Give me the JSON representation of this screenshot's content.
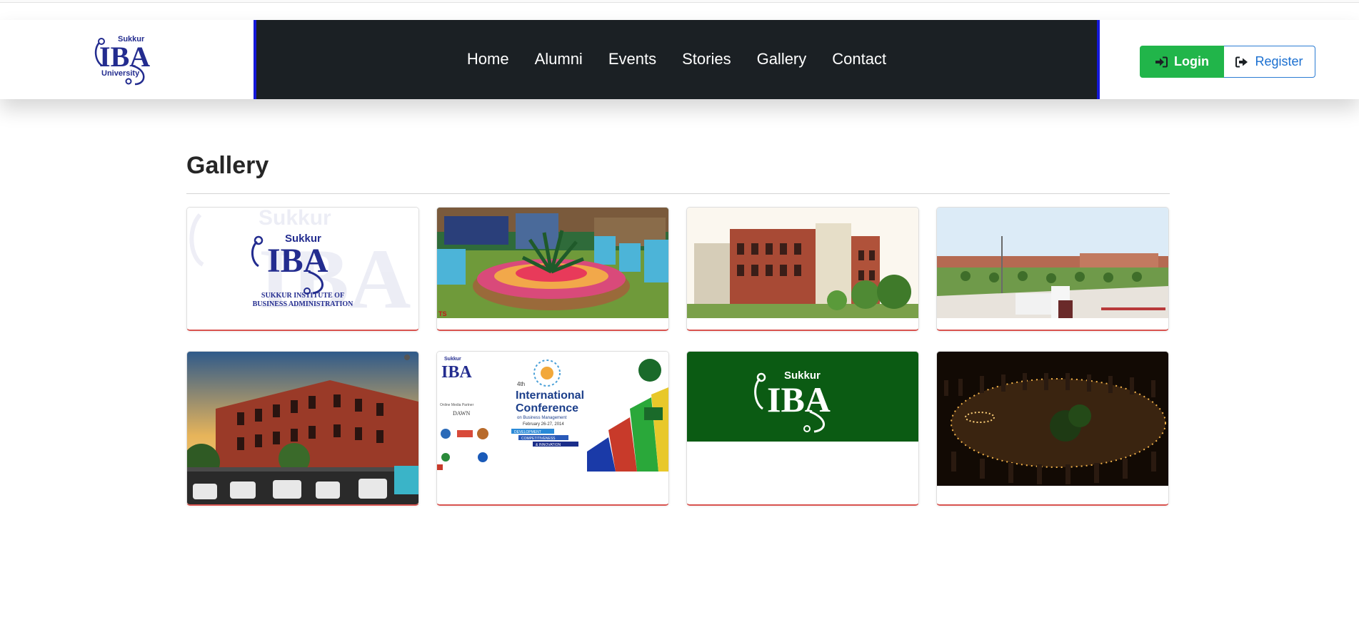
{
  "header": {
    "logo": {
      "alt": "Sukkur IBA University",
      "word_top": "Sukkur",
      "word_main": "IBA",
      "word_bottom": "University"
    },
    "nav": [
      {
        "label": "Home"
      },
      {
        "label": "Alumni"
      },
      {
        "label": "Events"
      },
      {
        "label": "Stories"
      },
      {
        "label": "Gallery"
      },
      {
        "label": "Contact"
      }
    ],
    "auth": {
      "login_label": "Login",
      "login_icon": "sign-in-icon",
      "register_label": "Register",
      "register_icon": "sign-out-icon"
    }
  },
  "page": {
    "title": "Gallery"
  },
  "gallery": {
    "items": [
      {
        "image": "sukkur-iba-logo-watermark",
        "text": {
          "top": "Sukkur",
          "main": "IBA",
          "line1": "Sukkur Institute of",
          "line2": "Business Administration"
        }
      },
      {
        "image": "flower-garden-event"
      },
      {
        "image": "campus-building-red-brick"
      },
      {
        "image": "campus-gate-lawn"
      },
      {
        "image": "campus-building-dramatic-sky"
      },
      {
        "image": "conference-poster",
        "text": {
          "logo_top": "Sukkur",
          "logo_main": "IBA",
          "edition": "4th",
          "title_1": "International",
          "title_2": "Conference",
          "subtitle": "on Business Management",
          "date": "February 26-27, 2014",
          "tag_1": "DEVELOPMENT",
          "tag_2": "COMPETITIVENESS",
          "tag_3": "& INNOVATION",
          "partner_label": "Online Media Partner",
          "partner": "DAWN"
        }
      },
      {
        "image": "sukkur-iba-green-logo",
        "text": {
          "top": "Sukkur",
          "main": "IBA"
        }
      },
      {
        "image": "candle-light-ceremony"
      }
    ]
  },
  "colors": {
    "navbar_bg": "#1b2024",
    "navbar_border": "#1418d8",
    "login_bg": "#21b54a",
    "register_text": "#1a6fd0",
    "card_accent": "#d9534f",
    "logo_blue": "#232c8f",
    "green_logo_bg": "#0b5b13"
  }
}
